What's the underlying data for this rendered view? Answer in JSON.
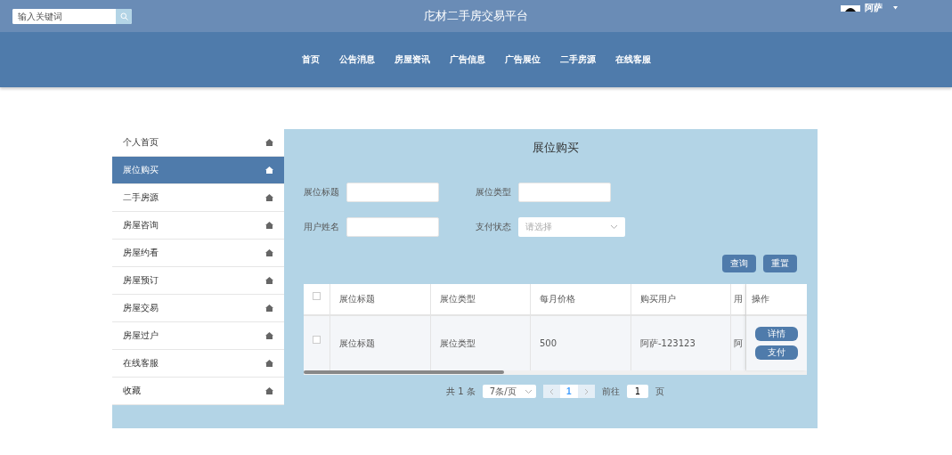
{
  "header": {
    "search": {
      "placeholder": "输入关键词"
    },
    "title": "庀材二手房交易平台",
    "user": {
      "name": "阿萨"
    }
  },
  "nav": [
    {
      "label": "首页"
    },
    {
      "label": "公告消息"
    },
    {
      "label": "房屋资讯"
    },
    {
      "label": "广告信息"
    },
    {
      "label": "广告展位"
    },
    {
      "label": "二手房源"
    },
    {
      "label": "在线客服"
    }
  ],
  "sidebar": {
    "items": [
      {
        "label": "个人首页",
        "selected": false
      },
      {
        "label": "展位购买",
        "selected": true
      },
      {
        "label": "二手房源",
        "selected": false
      },
      {
        "label": "房屋咨询",
        "selected": false
      },
      {
        "label": "房屋约看",
        "selected": false
      },
      {
        "label": "房屋预订",
        "selected": false
      },
      {
        "label": "房屋交易",
        "selected": false
      },
      {
        "label": "房屋过户",
        "selected": false
      },
      {
        "label": "在线客服",
        "selected": false
      },
      {
        "label": "收藏",
        "selected": false
      }
    ]
  },
  "panel": {
    "title": "展位购买",
    "filters": [
      {
        "label": "展位标题",
        "kind": "text"
      },
      {
        "label": "展位类型",
        "kind": "text"
      },
      {
        "label": "用户姓名",
        "kind": "text"
      },
      {
        "label": "支付状态",
        "kind": "select",
        "placeholder": "请选择"
      }
    ],
    "buttons": [
      "查询",
      "重置"
    ],
    "table": {
      "select_all_checked": false,
      "columns": [
        "展位标题",
        "展位类型",
        "每月价格",
        "购买用户",
        "用"
      ],
      "action_column": "操作",
      "rows": [
        {
          "checked": false,
          "cells": [
            "展位标题",
            "展位类型",
            "500",
            "阿萨-123123",
            "阿"
          ],
          "actions": [
            "详情",
            "支付"
          ]
        }
      ]
    },
    "pagination": {
      "total": "共 1 条",
      "page_size": "7条/页",
      "pages": [
        {
          "label": "1",
          "selected": true
        }
      ],
      "goto_label": "前往",
      "goto_value": "1",
      "goto_suffix": "页"
    }
  }
}
